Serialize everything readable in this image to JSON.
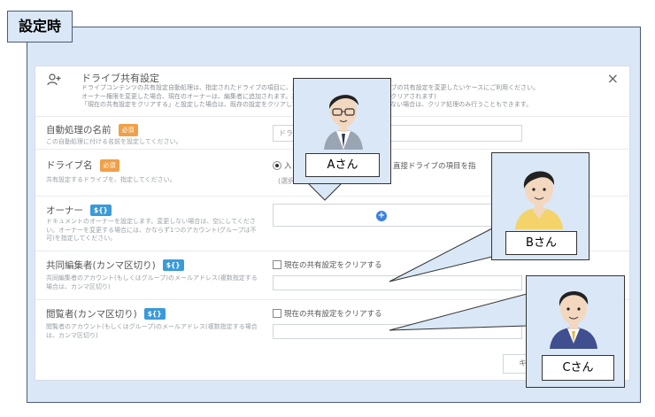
{
  "page_title": "設定時",
  "dialog": {
    "title": "ドライブ共有設定",
    "description": [
      "ドライブコンテンツの共有設定自動処理は、指定されたドライブの項目に、共有設定を変更したい時に、ドライブの共有設定を変更したいケースにご利用ください。",
      "オーナー権限を変更した場合、現在のオーナーは、編集者に追加されます。共有設定の変更に失敗した場合は、クリアされます)",
      "「現在の共有設定をクリアする」と設定した場合は、既存の設定をクリアしてから設定します。各項目を設定しない場合は、クリア処理のみ行うこともできます。"
    ],
    "close_label": "×",
    "fields": {
      "auto_name": {
        "label": "自動処理の名前",
        "badge": "必須",
        "sub": "この自動処理に付ける名前を設定してください。",
        "value": "ドライブ"
      },
      "drive_name": {
        "label": "ドライブ名",
        "badge": "必須",
        "sub": "共有設定するドライブを、指定してください。",
        "radio_selected": "入",
        "radio_other": "直接ドライブの項目を指",
        "select_value": "(選択"
      },
      "owner": {
        "label": "オーナー",
        "badge": "${}",
        "sub": "ドキュメントのオーナーを設定します。変更しない場合は、空にしてください。オーナーを変更する場合には、かならず1つのアカウント(グループは不可)を指定してください。"
      },
      "editors": {
        "label": "共同編集者(カンマ区切り)",
        "badge": "${}",
        "sub": "共同編集者のアカウント(もしくはグループ)のメールアドレス(複数指定する場合は、カンマ区切り)",
        "clear_label": "現在の共有設定をクリアする"
      },
      "viewers": {
        "label": "閲覧者(カンマ区切り)",
        "badge": "${}",
        "sub": "閲覧者のアカウント(もしくはグループ)のメールアドレス(複数指定する場合は、カンマ区切り)",
        "clear_label": "現在の共有設定をクリアする"
      }
    },
    "cancel_label": "キャ"
  },
  "callouts": {
    "a": {
      "name": "Aさん"
    },
    "b": {
      "name": "Bさん"
    },
    "c": {
      "name": "Cさん"
    }
  },
  "colors": {
    "frame_bg": "#dae7f6",
    "accent_blue": "#3b9ad8",
    "required_orange": "#f0a048"
  }
}
